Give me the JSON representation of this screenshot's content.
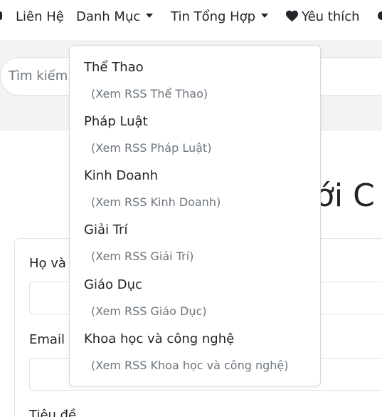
{
  "nav": {
    "items": [
      {
        "label": "Liên Hệ"
      },
      {
        "label": "Danh Mục"
      },
      {
        "label": "Tin Tổng Hợp"
      },
      {
        "label": "Yêu thích"
      }
    ],
    "heart_icon": "heart-icon",
    "caret_icon": "caret-down-icon"
  },
  "search": {
    "placeholder": "Tìm kiếm"
  },
  "page": {
    "heading_fragment": "ới C"
  },
  "form": {
    "name_label": "Họ và",
    "email_label": "Email",
    "subject_label": "Tiêu đề"
  },
  "dropdown": {
    "items": [
      {
        "label": "Thể Thao",
        "rss": "(Xem RSS Thể Thao)"
      },
      {
        "label": "Pháp Luật",
        "rss": "(Xem RSS Pháp Luật)"
      },
      {
        "label": "Kinh Doanh",
        "rss": "(Xem RSS Kinh Doanh)"
      },
      {
        "label": "Giải Trí",
        "rss": "(Xem RSS Giải Trí)"
      },
      {
        "label": "Giáo Dục",
        "rss": "(Xem RSS Giáo Dục)"
      },
      {
        "label": "Khoa học và công nghệ",
        "rss": "(Xem RSS Khoa học và công nghệ)"
      }
    ]
  },
  "colors": {
    "text": "#212529",
    "muted": "#6c757d",
    "band": "#f2f3f5",
    "border": "#dee2e6"
  }
}
